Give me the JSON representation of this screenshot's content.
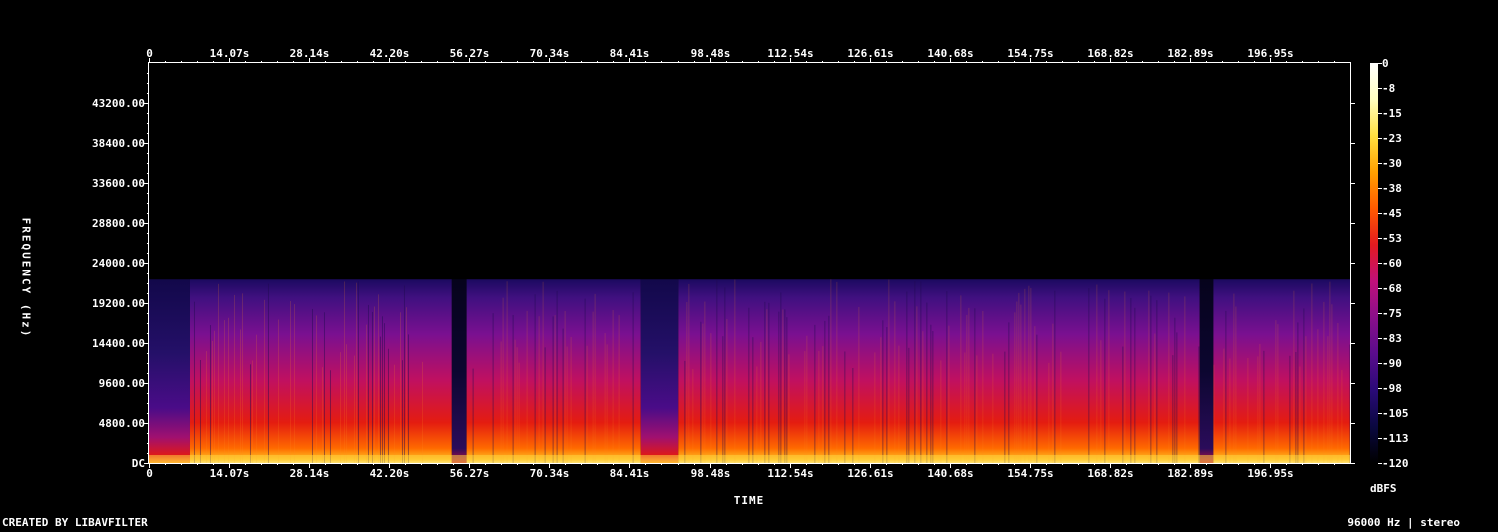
{
  "chart_data": {
    "type": "heatmap",
    "title": "",
    "xlabel": "TIME",
    "ylabel": "FREQUENCY (Hz)",
    "x_ticks": [
      "0",
      "14.07s",
      "28.14s",
      "42.20s",
      "56.27s",
      "70.34s",
      "84.41s",
      "98.48s",
      "112.54s",
      "126.61s",
      "140.68s",
      "154.75s",
      "168.82s",
      "182.89s",
      "196.95s"
    ],
    "x_tick_values": [
      0,
      14.07,
      28.14,
      42.2,
      56.27,
      70.34,
      84.41,
      98.48,
      112.54,
      126.61,
      140.68,
      154.75,
      168.82,
      182.89,
      196.95
    ],
    "xlim": [
      0,
      211
    ],
    "y_ticks": [
      "DC",
      "4800.00",
      "9600.00",
      "14400.00",
      "19200.00",
      "24000.00",
      "28800.00",
      "33600.00",
      "38400.00",
      "43200.00"
    ],
    "y_tick_values": [
      0,
      4800,
      9600,
      14400,
      19200,
      24000,
      28800,
      33600,
      38400,
      43200
    ],
    "ylim": [
      0,
      48000
    ],
    "content_cutoff_hz": 22050,
    "colorbar": {
      "label": "dBFS",
      "ticks": [
        "0",
        "-8",
        "-15",
        "-23",
        "-30",
        "-38",
        "-45",
        "-53",
        "-60",
        "-68",
        "-75",
        "-83",
        "-90",
        "-98",
        "-105",
        "-113",
        "-120"
      ],
      "range": [
        -120,
        0
      ],
      "colors": [
        "#000000",
        "#0a0840",
        "#2a0a78",
        "#5a0c8c",
        "#8a0f8a",
        "#c0107a",
        "#e31a20",
        "#ff5a00",
        "#ffa000",
        "#ffe040",
        "#ffffc0",
        "#ffffff"
      ]
    },
    "segments": [
      {
        "start": 0,
        "end": 7.2,
        "level": "quiet"
      },
      {
        "start": 7.2,
        "end": 53.2,
        "level": "loud"
      },
      {
        "start": 53.2,
        "end": 55.8,
        "level": "gap"
      },
      {
        "start": 55.8,
        "end": 86.4,
        "level": "loud"
      },
      {
        "start": 86.4,
        "end": 93.0,
        "level": "quiet"
      },
      {
        "start": 93.0,
        "end": 184.6,
        "level": "loud"
      },
      {
        "start": 184.6,
        "end": 187.0,
        "level": "gap"
      },
      {
        "start": 187.0,
        "end": 211.0,
        "level": "loud"
      }
    ]
  },
  "footer": {
    "credit": "CREATED BY LIBAVFILTER",
    "info": "96000 Hz | stereo"
  }
}
